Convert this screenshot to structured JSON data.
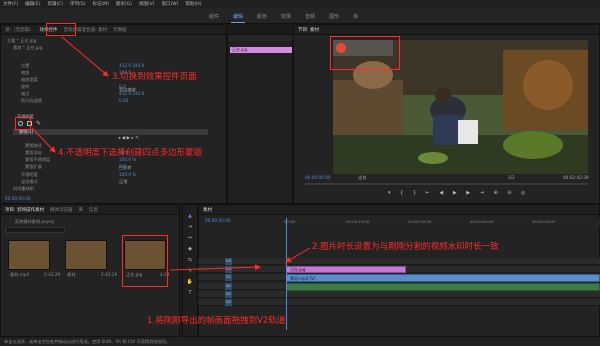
{
  "menu": [
    "文件(F)",
    "编辑(E)",
    "剪辑(C)",
    "序列(S)",
    "标记(M)",
    "图形(G)",
    "视图(V)",
    "窗口(W)",
    "帮助(H)"
  ],
  "workspace_tabs": [
    {
      "label": "组件",
      "active": false
    },
    {
      "label": "编辑",
      "active": true
    },
    {
      "label": "颜色",
      "active": false
    },
    {
      "label": "效果",
      "active": false
    },
    {
      "label": "音频",
      "active": false
    },
    {
      "label": "图形",
      "active": false
    },
    {
      "label": "库",
      "active": false
    }
  ],
  "effects_panel": {
    "tabs": [
      "源:（无剪辑）",
      "效果控件",
      "音频剪辑混合器: 素材",
      "元数据"
    ],
    "header_src": "主要 * 正在.jpg",
    "header_seq": "素材 * 正在.jpg",
    "motion_rows": [
      "位置",
      "缩放",
      "缩放宽度",
      "旋转",
      "锚点",
      "防闪烁滤镜"
    ],
    "motion_vals": [
      "432.0   240.0",
      "100.0",
      "",
      "0.0",
      "432.0   240.0",
      "0.00"
    ],
    "uniform_scale": "等比缩放",
    "opacity_label": "不透明度",
    "mask_label": "蒙版(1)",
    "mask_rows": [
      "蒙版路径",
      "蒙版羽化",
      "蒙版不透明度",
      "蒙版扩展"
    ],
    "mask_vals": [
      "",
      "10.0",
      "100.0 %",
      "0.0"
    ],
    "inverted": "已反转",
    "opacity_value_label": "不透明度",
    "opacity_value": "100.0 %",
    "blend_label": "混合模式",
    "blend_value": "正常",
    "time_remap": "时间重映射",
    "timecode": "00:00:00:00",
    "clip_label": "正在.jpg"
  },
  "program": {
    "title": "节目: 素材",
    "timecode": "00:00:00:00",
    "fit": "适合",
    "quality": "1/2",
    "duration": "00:02:42:29"
  },
  "project": {
    "tabs": [
      "项目: 剪映操作素材",
      "媒体浏览器",
      "库",
      "信息"
    ],
    "path": "剪映操作素材.prproj",
    "items": [
      {
        "name": "素材.mp4",
        "dur": "2:42:29"
      },
      {
        "name": "素材",
        "dur": "2:42:29"
      },
      {
        "name": "正在.jpg",
        "dur": "4:29"
      }
    ]
  },
  "timeline": {
    "title": "素材",
    "timecode": "00:00:00:00",
    "ruler": [
      "00:00",
      "00:00:15:00",
      "00:00:30:00",
      "00:00:45:00",
      "00:01:00:00"
    ],
    "tracks_v": [
      "V3",
      "V2",
      "V1"
    ],
    "tracks_a": [
      "A1",
      "A2",
      "A3"
    ],
    "clip_v2": "正在.jpg",
    "clip_v1": "素材.mp4 [V]"
  },
  "annotations": {
    "a1": "1.将刚刚导出的帧画面拖拽到V2轨道",
    "a2": "2.图片时长设置为与刚刚分割的视频水印时长一致",
    "a3": "3.切换到效果控件页面",
    "a4": "4.不透明度下选择创建四点多边形蒙版"
  },
  "status": "单击以选择，或单击空白处并拖动以进行框选。使用 Shift、Alt 和 Ctrl 可获得其他选项。"
}
